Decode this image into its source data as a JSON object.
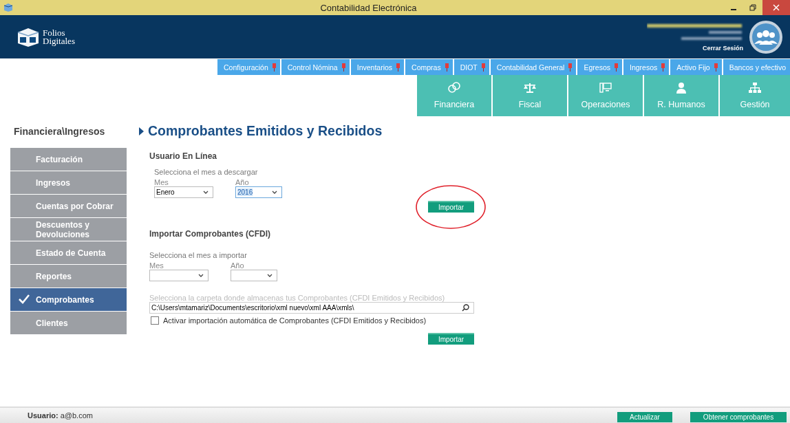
{
  "window": {
    "title": "Contabilidad Electrónica"
  },
  "header": {
    "logo_line_1": "Folios",
    "logo_line_2": "Digitales",
    "logout": "Cerrar Sesión"
  },
  "nav_tabs": [
    {
      "label": "Configuración",
      "pinned": true
    },
    {
      "label": "Control Nómina",
      "pinned": true
    },
    {
      "label": "Inventarios",
      "pinned": true
    },
    {
      "label": "Compras",
      "pinned": true
    },
    {
      "label": "DIOT",
      "pinned": true
    },
    {
      "label": "Contabilidad General",
      "pinned": true
    },
    {
      "label": "Egresos",
      "pinned": true
    },
    {
      "label": "Ingresos",
      "pinned": true
    },
    {
      "label": "Activo Fijo",
      "pinned": true
    },
    {
      "label": "Bancos y efectivo",
      "pinned": false
    }
  ],
  "modules": [
    {
      "label": "Financiera",
      "kind": "coins"
    },
    {
      "label": "Fiscal",
      "kind": "scale"
    },
    {
      "label": "Operaciones",
      "kind": "monitor"
    },
    {
      "label": "R. Humanos",
      "kind": "person"
    },
    {
      "label": "Gestión",
      "kind": "org"
    }
  ],
  "sidebar": {
    "breadcrumb": "Financiera\\Ingresos",
    "items": [
      {
        "label": "Facturación",
        "selected": false
      },
      {
        "label": "Ingresos",
        "selected": false
      },
      {
        "label": "Cuentas por Cobrar",
        "selected": false
      },
      {
        "label": "Descuentos y Devoluciones",
        "selected": false
      },
      {
        "label": "Estado de Cuenta",
        "selected": false
      },
      {
        "label": "Reportes",
        "selected": false
      },
      {
        "label": "Comprobantes",
        "selected": true
      },
      {
        "label": "Clientes",
        "selected": false
      }
    ]
  },
  "page_title": "Comprobantes Emitidos y Recibidos",
  "online": {
    "heading": "Usuario En Línea",
    "hint": "Selecciona el mes a descargar",
    "month_label": "Mes",
    "month_value": "Enero",
    "year_label": "Año",
    "year_value": "2016",
    "year_focused": true,
    "button": "Importar",
    "button_circled": true
  },
  "import": {
    "heading": "Importar Comprobantes (CFDI)",
    "hint": "Selecciona el mes a importar",
    "month_label": "Mes",
    "year_label": "Año",
    "folder_label": "Selecciona la carpeta donde almacenas tus Comprobantes (CFDI Emitidos y Recibidos)",
    "folder_value": "C:\\Users\\mtamariz\\Documents\\escritorio\\xml nuevo\\xml AAA\\xmls\\",
    "auto_label": "Activar importación automática de Comprobantes (CFDI Emitidos y Recibidos)",
    "auto_checked": false,
    "button": "Importar"
  },
  "status_bar": {
    "user_label": "Usuario:",
    "user_value": "a@b.com",
    "buttons": [
      "Actualizar",
      "Obtener comprobantes"
    ]
  }
}
